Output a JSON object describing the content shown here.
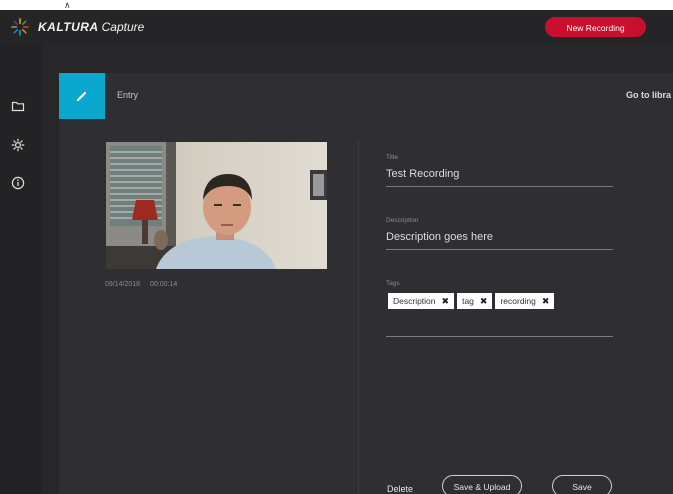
{
  "app": {
    "brand_name": "KALTURA",
    "brand_suffix": "Capture",
    "new_recording_label": "New Recording"
  },
  "header": {
    "entry_label": "Entry",
    "go_to_library_label": "Go to libra"
  },
  "recording": {
    "date": "09/14/2018",
    "duration": "00:00:14"
  },
  "form": {
    "title_label": "Title",
    "title_value": "Test Recording",
    "description_label": "Description",
    "description_value": "Description goes here",
    "tags_label": "Tags",
    "tags": [
      "Description",
      "tag",
      "recording"
    ]
  },
  "actions": {
    "delete_label": "Delete",
    "save_upload_label": "Save & Upload",
    "save_label": "Save"
  },
  "colors": {
    "accent": "#0aa8ce",
    "record": "#c8102e",
    "background": "#2b2b2e"
  }
}
